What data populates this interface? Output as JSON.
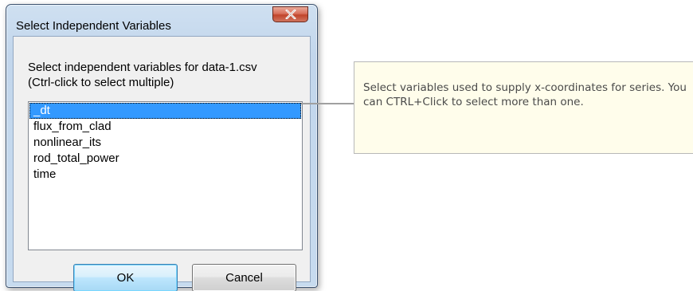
{
  "dialog": {
    "title": "Select Independent Variables",
    "close_icon": "close-icon",
    "prompt": "Select independent variables for data-1.csv\n(Ctrl-click to select multiple)",
    "list": {
      "items": [
        {
          "label": "_dt",
          "selected": true
        },
        {
          "label": "flux_from_clad",
          "selected": false
        },
        {
          "label": "nonlinear_its",
          "selected": false
        },
        {
          "label": "rod_total_power",
          "selected": false
        },
        {
          "label": "time",
          "selected": false
        }
      ]
    },
    "ok_label": "OK",
    "cancel_label": "Cancel"
  },
  "callout": {
    "text": "Select variables used to supply x-coordinates for series. You can CTRL+Click to select more than one."
  },
  "colors": {
    "selection": "#3399ff",
    "callout_background": "#fffdeb",
    "close_button": "#c1452b"
  }
}
